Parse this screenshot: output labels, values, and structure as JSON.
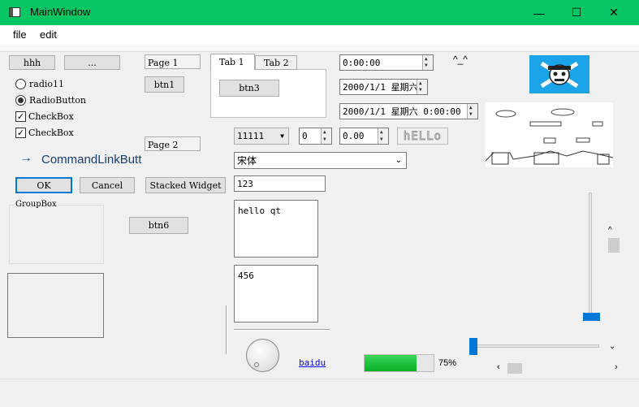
{
  "window": {
    "title": "MainWindow",
    "minimize": "—",
    "maximize": "☐",
    "close": "✕"
  },
  "menu": [
    "file",
    "edit"
  ],
  "buttons": {
    "hhh": "hhh",
    "dots": "...",
    "btn1": "btn1",
    "btn3": "btn3",
    "btn6": "btn6",
    "ok": "OK",
    "cancel": "Cancel",
    "stacked": "Stacked Widget"
  },
  "toolbox": {
    "page1": "Page 1",
    "page2": "Page 2"
  },
  "tabs": [
    "Tab 1",
    "Tab 2"
  ],
  "radios": [
    {
      "label": "radio11",
      "checked": false
    },
    {
      "label": "RadioButton",
      "checked": true
    }
  ],
  "checkboxes": [
    {
      "label": "CheckBox",
      "checked": true
    },
    {
      "label": "CheckBox",
      "checked": true
    }
  ],
  "command_link": "CommandLinkButt",
  "groupbox": "GroupBox",
  "time_edit": "0:00:00",
  "date_edit": "2000/1/1 星期六",
  "datetime_edit": "2000/1/1 星期六 0:00:00",
  "emoticon": "^_^",
  "combo_value": "11111",
  "spin_int": "0",
  "spin_double": "0.00",
  "lcd_text": "hELLo",
  "font_combo": "宋体",
  "line_edit": "123",
  "text_edit_1": "hello qt",
  "text_edit_2": "456",
  "link": "baidu",
  "progress": {
    "value": 75,
    "label": "75%"
  },
  "colors": {
    "titlebar": "#06c663",
    "accent": "#0078d7",
    "progress": "#06b025",
    "link": "#0000ee"
  }
}
